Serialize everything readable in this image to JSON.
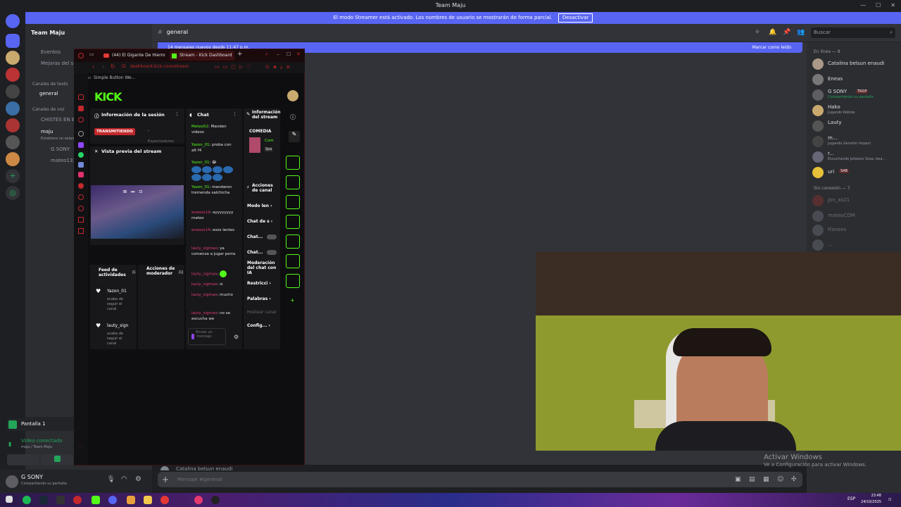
{
  "titlebar": {
    "title": "Team Maju"
  },
  "banner": {
    "text": "El modo Streamer está activado. Los nombres de usuario se mostrarán de forma parcial.",
    "button": "Desactivar"
  },
  "server": {
    "name": "Team Maju"
  },
  "channels": {
    "events": "Eventos",
    "boosts": "Mejoras del s",
    "text_category": "Canales de texto",
    "general": "general",
    "voice_category": "Canales de voz",
    "jokes": "CHISTES EN E",
    "maju": "maju",
    "maju_status": "Establece un estado",
    "voice_users": [
      "G SONY",
      "mateo133"
    ]
  },
  "screen": {
    "label": "Pantalla 1"
  },
  "voice": {
    "status": "Vídeo conectado",
    "location": "maju / Team Maju"
  },
  "user": {
    "name": "G SONY",
    "status": "Compartiendo su pantalla"
  },
  "header": {
    "channel": "general",
    "search_placeholder": "Buscar"
  },
  "newbar": {
    "left": "14 mensajes nuevos desde 11:47 p.m.",
    "right": "Marcar como leído"
  },
  "composer": {
    "placeholder": "Mensaje #general"
  },
  "typing": {
    "text": "Catalina belsun enaudi"
  },
  "members": {
    "online_header": "En línea — 8",
    "offline_header": "Sin conexión — 7",
    "online": [
      {
        "name": "Catalina belsun enaudi",
        "status": ""
      },
      {
        "name": "Eneas",
        "status": ""
      },
      {
        "name": "G SONY",
        "status": "Compartiendo su pantalla",
        "badge": "TROP"
      },
      {
        "name": "Hako",
        "status": "Jugando Roblox"
      },
      {
        "name": "Lauty",
        "status": ""
      },
      {
        "name": "m...",
        "status": "Jugando Genshin Impact"
      },
      {
        "name": "r...",
        "status": "Escuchando Julieano Sosa, bea..."
      },
      {
        "name": "uri",
        "status": "",
        "badge": "SAB"
      }
    ],
    "offline": [
      "Jon_as21",
      "mateoCDM",
      "tfanees",
      "..."
    ]
  },
  "browser": {
    "tabs": [
      "(44) El Gigante De Hierro",
      "Stream - Kick Dashboard"
    ],
    "url": "dashboard.kick.com/stream",
    "bookmark": "Simple Button We..."
  },
  "kick": {
    "logo": "KICK",
    "session_title": "Información de la sesión",
    "live_badge": "TRANSMITIENDO",
    "dash": "-",
    "viewers_label": "Espectadores",
    "preview_title": "Vista previa del stream",
    "activity_title": "Feed de actividades",
    "mod_actions_title": "Acciones de moderador",
    "filter_short": "Fi",
    "filter_short2": "Fil",
    "activity": [
      {
        "user": "Yazon_01",
        "text": "acaba de seguir el canal"
      },
      {
        "user": "lauty_sign",
        "text": "acaba de seguir el canal"
      }
    ],
    "chat_title": "Chat",
    "chat": [
      {
        "user": "Meteo52",
        "msg": "Manden videos"
      },
      {
        "user": "Yazon_01",
        "msg": "proba con alt f4"
      },
      {
        "user": "Yazon_01",
        "msg": "😂"
      },
      {
        "user": "Yazon_01",
        "msg": "mandaron tremenda salchicha"
      },
      {
        "user": "eneass14",
        "msg": "ayyyyyyyy mateo"
      },
      {
        "user": "eneass14",
        "msg": "esos lentes"
      },
      {
        "user": "lauty_sigmao",
        "msg": "ya comenza a jugar perra"
      },
      {
        "user": "lauty_sigmao",
        "msg": ""
      },
      {
        "user": "lauty_sigmao",
        "msg": "si"
      },
      {
        "user": "lauty_sigmao",
        "msg": "mucho"
      },
      {
        "user": "lauty_sigmao",
        "msg": "no se escucha we"
      }
    ],
    "chat_send": "Enviar un mensaje",
    "info_title": "Información del stream",
    "category": "COMEDIA",
    "cat_short1": "Com",
    "cat_short2": "Spa",
    "channel_actions": "Acciones de canal",
    "actions": [
      "Modo len",
      "Chat de s",
      "Chat...",
      "Chat...",
      "Moderación del chat con IA",
      "Restricci",
      "Palabras",
      "Hostear canal",
      "Config..."
    ]
  },
  "windows": {
    "activate_title": "Activar Windows",
    "activate_sub": "Ve a Configuración para activar Windows."
  },
  "taskbar": {
    "lang": "ESP",
    "time": "23:48",
    "date": "24/10/2025"
  }
}
